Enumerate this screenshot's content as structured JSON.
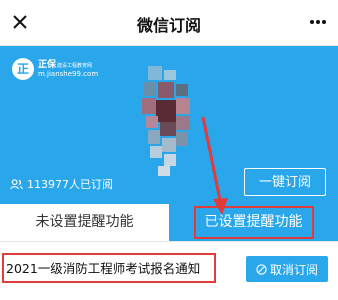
{
  "header": {
    "title": "微信订阅",
    "close_icon": "close-icon",
    "more_icon": "more-icon"
  },
  "banner": {
    "logo": {
      "mark": "正",
      "name": "正保",
      "name_small": "建设工程教育网",
      "url": "m.jianshe99.com"
    },
    "subscribers_text": "113977人已订阅",
    "subscribe_all_label": "一键订阅",
    "colors": {
      "background": "#2aa6ea"
    }
  },
  "tabs": {
    "unset_label": "未设置提醒功能",
    "set_label": "已设置提醒功能",
    "active": "set"
  },
  "list": {
    "items": [
      {
        "label": "2021一级消防工程师考试报名通知",
        "action_label": "取消订阅"
      }
    ]
  },
  "colors": {
    "accent": "#2aa6ea",
    "highlight": "#e23b3b"
  }
}
